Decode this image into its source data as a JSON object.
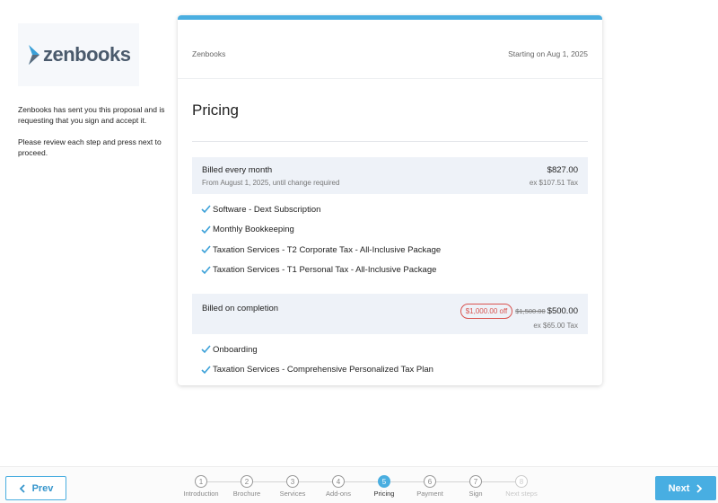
{
  "sidebar": {
    "logo_text": "zenbooks",
    "message": "Zenbooks has sent you this proposal and is requesting that you sign and accept it.",
    "instructions": "Please review each step and press next to proceed."
  },
  "card": {
    "company": "Zenbooks",
    "start": "Starting on Aug 1, 2025",
    "title": "Pricing",
    "monthly": {
      "label": "Billed every month",
      "sub": "From August 1, 2025, until change required",
      "amount": "$827.00",
      "tax": "ex $107.51 Tax",
      "items": [
        "Software - Dext Subscription",
        "Monthly Bookkeeping",
        "Taxation Services - T2 Corporate Tax - All-Inclusive Package",
        "Taxation Services - T1 Personal Tax - All-Inclusive Package"
      ]
    },
    "completion": {
      "label": "Billed on completion",
      "discount": "$1,000.00 off",
      "original": "$1,500.00",
      "amount": "$500.00",
      "tax": "ex $65.00 Tax",
      "items": [
        "Onboarding",
        "Taxation Services - Comprehensive Personalized Tax Plan"
      ]
    }
  },
  "footer": {
    "prev": "Prev",
    "next": "Next",
    "steps": [
      {
        "num": "1",
        "label": "Introduction"
      },
      {
        "num": "2",
        "label": "Brochure"
      },
      {
        "num": "3",
        "label": "Services"
      },
      {
        "num": "4",
        "label": "Add-ons"
      },
      {
        "num": "5",
        "label": "Pricing"
      },
      {
        "num": "6",
        "label": "Payment"
      },
      {
        "num": "7",
        "label": "Sign"
      },
      {
        "num": "8",
        "label": "Next steps"
      }
    ]
  },
  "colors": {
    "accent": "#4aaee0",
    "discount": "#d9534f",
    "check": "#3aa0d8"
  }
}
